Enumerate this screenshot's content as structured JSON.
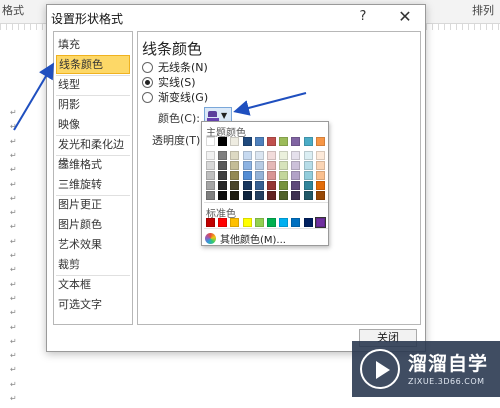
{
  "background": {
    "ribbon": {
      "left_text": "格式",
      "right_text": "排列"
    },
    "paragraph_mark": "↵"
  },
  "dialog": {
    "title": "设置形状格式",
    "help_label": "?",
    "close_label": "✕",
    "nav_items": [
      {
        "label": "填充",
        "selected": false
      },
      {
        "label": "线条颜色",
        "selected": true
      },
      {
        "label": "线型",
        "selected": false
      },
      {
        "label": "阴影",
        "selected": false
      },
      {
        "label": "映像",
        "selected": false
      },
      {
        "label": "发光和柔化边缘",
        "selected": false
      },
      {
        "label": "三维格式",
        "selected": false
      },
      {
        "label": "三维旋转",
        "selected": false
      },
      {
        "label": "图片更正",
        "selected": false
      },
      {
        "label": "图片颜色",
        "selected": false
      },
      {
        "label": "艺术效果",
        "selected": false
      },
      {
        "label": "裁剪",
        "selected": false
      },
      {
        "label": "文本框",
        "selected": false
      },
      {
        "label": "可选文字",
        "selected": false
      }
    ],
    "panel": {
      "title": "线条颜色",
      "options": [
        {
          "label": "无线条(N)",
          "checked": false
        },
        {
          "label": "实线(S)",
          "checked": true
        },
        {
          "label": "渐变线(G)",
          "checked": false
        }
      ],
      "color_label": "颜色(C):",
      "transparency_label": "透明度(T):",
      "selected_color": "#6a44b3"
    },
    "close_button": "关闭"
  },
  "color_popup": {
    "theme_header": "主题颜色",
    "theme_top": [
      "#ffffff",
      "#000000",
      "#eeece1",
      "#1f497d",
      "#4f81bd",
      "#c0504d",
      "#9bbb59",
      "#8064a2",
      "#4bacc6",
      "#f79646"
    ],
    "theme_shades": [
      [
        "#f2f2f2",
        "#7f7f7f",
        "#ddd9c3",
        "#c6d9f0",
        "#dbe5f1",
        "#f2dcdb",
        "#ebf1dd",
        "#e5e0ec",
        "#dbeef3",
        "#fdeada"
      ],
      [
        "#d8d8d8",
        "#595959",
        "#c4bd97",
        "#8db3e2",
        "#b8cce4",
        "#e5b9b7",
        "#d7e3bc",
        "#ccc1d9",
        "#b7dde8",
        "#fbd5b5"
      ],
      [
        "#bfbfbf",
        "#3f3f3f",
        "#938953",
        "#548dd4",
        "#95b3d7",
        "#d99694",
        "#c3d69b",
        "#b2a2c7",
        "#92cddc",
        "#fac08f"
      ],
      [
        "#a5a5a5",
        "#262626",
        "#494429",
        "#17365d",
        "#366092",
        "#953734",
        "#76923c",
        "#5f497a",
        "#31859b",
        "#e36c09"
      ],
      [
        "#7f7f7f",
        "#0c0c0c",
        "#1d1b10",
        "#0f243e",
        "#244061",
        "#632423",
        "#4f6128",
        "#3f3151",
        "#205867",
        "#974806"
      ]
    ],
    "standard_header": "标准色",
    "standard": [
      "#c00000",
      "#ff0000",
      "#ffc000",
      "#ffff00",
      "#92d050",
      "#00b050",
      "#00b0f0",
      "#0070c0",
      "#002060",
      "#7030a0"
    ],
    "more_colors": "其他颜色(M)..."
  },
  "watermark": {
    "name": "溜溜自学",
    "url": "ZIXUE.3D66.COM"
  }
}
